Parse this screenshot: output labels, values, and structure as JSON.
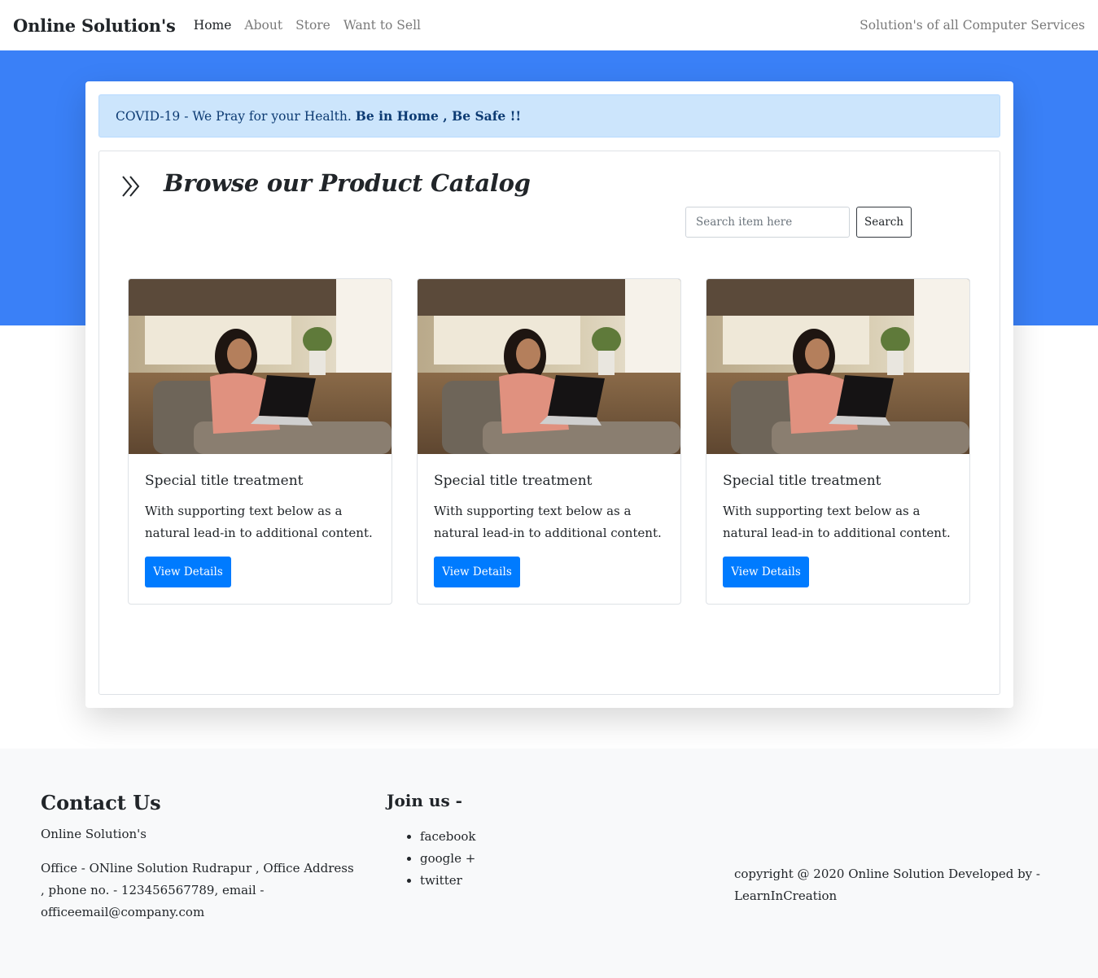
{
  "navbar": {
    "brand": "Online Solution's",
    "links": [
      {
        "label": "Home",
        "active": true
      },
      {
        "label": "About",
        "active": false
      },
      {
        "label": "Store",
        "active": false
      },
      {
        "label": "Want to Sell",
        "active": false
      }
    ],
    "right_text": "Solution's of all Computer Services"
  },
  "alert": {
    "text": "COVID-19 - We Pray for your Health.",
    "bold_text": "Be in Home , Be Safe !!"
  },
  "catalog": {
    "icon": "double-chevron-right-icon",
    "title": "Browse our Product Catalog",
    "search_placeholder": "Search item here",
    "search_value": "",
    "search_button": "Search"
  },
  "products": [
    {
      "image": "woman-with-laptop-photo",
      "title": "Special title treatment",
      "text": "With supporting text below as a natural lead-in to additional content.",
      "button": "View Details"
    },
    {
      "image": "woman-with-laptop-photo",
      "title": "Special title treatment",
      "text": "With supporting text below as a natural lead-in to additional content.",
      "button": "View Details"
    },
    {
      "image": "woman-with-laptop-photo",
      "title": "Special title treatment",
      "text": "With supporting text below as a natural lead-in to additional content.",
      "button": "View Details"
    }
  ],
  "footer": {
    "contact_title": "Contact Us",
    "contact_name": "Online Solution's",
    "contact_address": "Office - ONline Solution Rudrapur , Office Address , phone no. - 123456567789, email - officeemail@company.com",
    "join_title": "Join us -",
    "join_links": [
      "facebook",
      "google +",
      "twitter"
    ],
    "copyright": "copyright @ 2020 Online Solution Developed by - LearnInCreation"
  },
  "colors": {
    "hero_blue": "#3a80f7",
    "primary_button": "#007bff",
    "alert_bg": "#cce5fc",
    "alert_text": "#0d3b73",
    "footer_bg": "#f8f9fa"
  }
}
